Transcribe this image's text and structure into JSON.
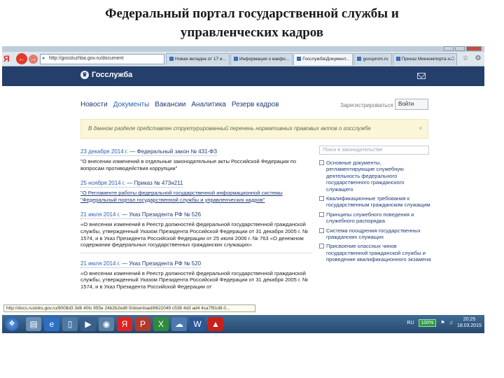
{
  "slide": {
    "title_line1": "Федеральный портал государственной службы и",
    "title_line2": "управленческих кадров"
  },
  "browser": {
    "address": "http://gossluzhba.gov.ru/document",
    "tabs": [
      {
        "label": "Новая вкладка от 17 и...",
        "active": false
      },
      {
        "label": "Информация о вакфо...",
        "active": false
      },
      {
        "label": "Госслужба\\Документ...",
        "active": true
      },
      {
        "label": "gossprom.ru",
        "active": false
      },
      {
        "label": "Приказ Минкомпорта и...",
        "active": false
      }
    ]
  },
  "site": {
    "logo": "Госслужба",
    "nav": [
      "Новости",
      "Документы",
      "Вакансии",
      "Аналитика",
      "Резерв кадров"
    ],
    "register": "Зарегистрироваться",
    "login": "Войти",
    "notice": "В данном разделе представлен структурированный перечень нормативных правовых актов о госслужбе"
  },
  "news": [
    {
      "date": "23 декабря 2014 г.",
      "type": "— Федеральный закон № 431-ФЗ",
      "text": "\"О внесении изменений в отдельные законодательные акты Российской Федерации по вопросам противодействия коррупции\"",
      "linked": false
    },
    {
      "date": "25 ноября 2014 г.",
      "type": "— Приказ № 473н211",
      "text": "\"О Регламенте работы федеральной государственной информационной системы \"Федеральный портал государственной службы и управленческих кадров\"",
      "linked": true
    },
    {
      "date": "21 июля 2014 г.",
      "type": "— Указ Президента РФ № 526",
      "text": "«О внесении изменений в Реестр должностей федеральной государственной гражданской службы, утвержденный Указом Президента Российской Федерации от 31 декабря 2005 г. № 1574, и в Указ Президента Российской Федерации от 25 июля 2006 г. № 763 «О денежном содержании федеральных государственных гражданских служащих»",
      "linked": false
    },
    {
      "date": "21 июля 2014 г.",
      "type": "— Указ Президента РФ № 520",
      "text": "«О внесении изменений в Реестр должностей федеральной государственной гражданской службы, утвержденный Указом Президента Российской Федерации от 31 декабря 2005 г. № 1574, и в Указ Президента Российской Федерации от",
      "linked": false
    }
  ],
  "sidebar": {
    "search_placeholder": "Поиск в законодательстве",
    "categories": [
      "Основные документы, регламентирующие служебную деятельность федерального государственного гражданского служащего",
      "Квалификационные требования к государственным гражданским служащим",
      "Принципы служебного поведения и служебного распорядка",
      "Система поощрения государственных гражданских служащих",
      "Присвоение классных чинов государственной гражданской службы и проведение квалификационного экзамена"
    ]
  },
  "statusbar": "http://docs.rustoks.gov.ru/8008d3 3d6 40ts 955e 24b2b2ed8 0/download/8622049 c538 4d3 ad4 4ca7f91d8.0...",
  "taskbar": {
    "lang": "RU",
    "zoom": "100%",
    "time": "20:25",
    "date": "18.03.2015"
  },
  "colors": {
    "site_header": "#253f6b",
    "link": "#1f3c78",
    "notice_bg": "#fbf6d7",
    "taskbar": "#27486d"
  }
}
